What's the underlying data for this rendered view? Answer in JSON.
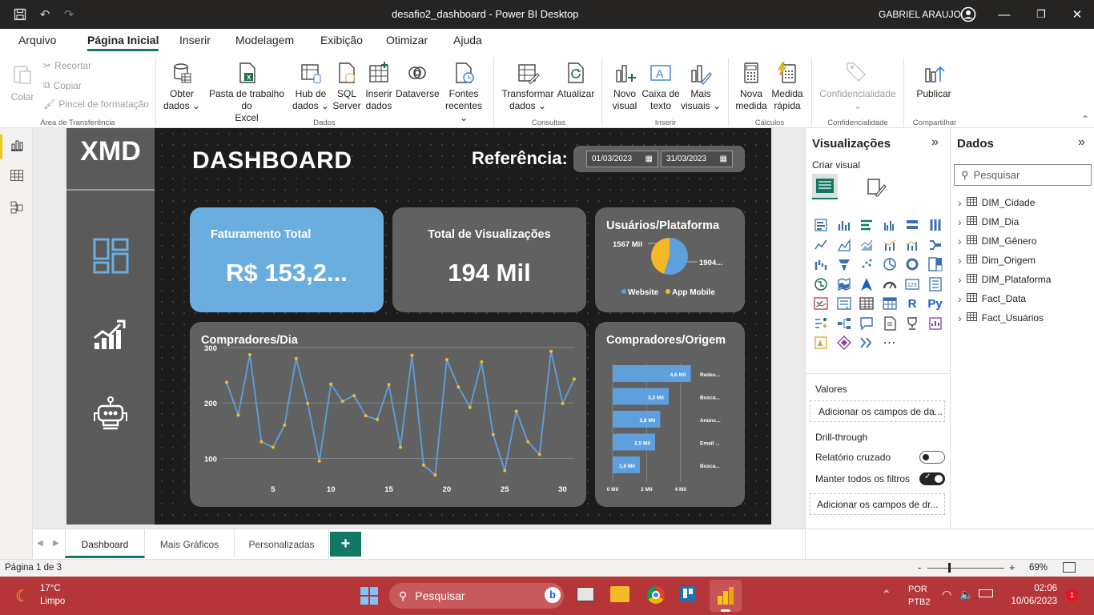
{
  "window": {
    "title": "desafio2_dashboard - Power BI Desktop",
    "user": "GABRIEL ARAUJO"
  },
  "ribbon_tabs": [
    "Arquivo",
    "Página Inicial",
    "Inserir",
    "Modelagem",
    "Exibição",
    "Otimizar",
    "Ajuda"
  ],
  "ribbon": {
    "paste": "Colar",
    "cut": "Recortar",
    "copy": "Copiar",
    "format_painter": "Pincel de formatação",
    "get_data": [
      "Obter",
      "dados ⌄"
    ],
    "excel": [
      "Pasta de trabalho do",
      "Excel"
    ],
    "hub": [
      "Hub de",
      "dados ⌄"
    ],
    "sql": [
      "SQL",
      "Server"
    ],
    "enter_data": [
      "Inserir",
      "dados"
    ],
    "dataverse": "Dataverse",
    "recent": [
      "Fontes",
      "recentes ⌄"
    ],
    "transform": [
      "Transformar",
      "dados ⌄"
    ],
    "refresh": "Atualizar",
    "new_visual": [
      "Novo",
      "visual"
    ],
    "textbox": [
      "Caixa de",
      "texto"
    ],
    "more_visuals": [
      "Mais",
      "visuais ⌄"
    ],
    "new_measure": [
      "Nova",
      "medida"
    ],
    "quick_measure": [
      "Medida",
      "rápida"
    ],
    "sensitivity": "Confidencialidade",
    "publish": "Publicar",
    "groups": [
      "Área de Transferência",
      "Dados",
      "Consultas",
      "Inserir",
      "Cálculos",
      "Confidencialidade",
      "Compartilhar"
    ]
  },
  "report": {
    "logo": "XMD",
    "title": "DASHBOARD",
    "reference_label": "Referência:",
    "date_from": "01/03/2023",
    "date_to": "31/03/2023",
    "kpi1": {
      "label": "Faturamento Total",
      "value": "R$ 153,2..."
    },
    "kpi2": {
      "label": "Total de Visualizações",
      "value": "194 Mil"
    },
    "pie": {
      "title": "Usuários/Plataforma",
      "label_a": "1567 Mil",
      "label_b": "1904...",
      "legend": [
        "Website",
        "App Mobile"
      ]
    },
    "line_title": "Compradores/Dia",
    "bar_title": "Compradores/Origem"
  },
  "chart_data": [
    {
      "type": "pie",
      "title": "Usuários/Plataforma",
      "labels": [
        "Website",
        "App Mobile"
      ],
      "values": [
        1904,
        1567
      ],
      "colors": [
        "#5ea0de",
        "#f4b927"
      ]
    },
    {
      "type": "line",
      "title": "Compradores/Dia",
      "x": [
        1,
        2,
        3,
        4,
        5,
        6,
        7,
        8,
        9,
        10,
        11,
        12,
        13,
        14,
        15,
        16,
        17,
        18,
        19,
        20,
        21,
        22,
        23,
        24,
        25,
        26,
        27,
        28,
        29,
        30,
        31
      ],
      "values": [
        237,
        178,
        287,
        130,
        120,
        160,
        280,
        199,
        95,
        234,
        203,
        213,
        177,
        170,
        233,
        120,
        286,
        88,
        70,
        278,
        229,
        192,
        274,
        143,
        78,
        185,
        130,
        107,
        293,
        199,
        243
      ],
      "xticks": [
        5,
        10,
        15,
        20,
        25,
        30
      ],
      "yticks": [
        100,
        200,
        300
      ],
      "ylim": [
        50,
        310
      ]
    },
    {
      "type": "bar",
      "title": "Compradores/Origem",
      "categories": [
        "Redes...",
        "Busca...",
        "Anúnc...",
        "Email ...",
        "Busca..."
      ],
      "values": [
        4.6,
        3.3,
        2.8,
        2.5,
        1.6
      ],
      "value_labels": [
        "4,6 Mil",
        "3,3 Mil",
        "2,8 Mil",
        "2,5 Mil",
        "1,6 Mil"
      ],
      "xticks": [
        "0 Mil",
        "2 Mil",
        "4 Mil"
      ],
      "xlim": [
        0,
        5
      ]
    }
  ],
  "viz_pane": {
    "title": "Visualizações",
    "build": "Criar visual",
    "values_label": "Valores",
    "values_placeholder": "Adicionar os campos de da...",
    "drill": "Drill-through",
    "cross": "Relatório cruzado",
    "keep": "Manter todos os filtros",
    "drill_placeholder": "Adicionar os campos de dr..."
  },
  "data_pane": {
    "title": "Dados",
    "search": "Pesquisar",
    "fields": [
      "DIM_Cidade",
      "DIM_Dia",
      "DIM_Gênero",
      "Dim_Origem",
      "DIM_Plataforma",
      "Fact_Data",
      "Fact_Usuários"
    ]
  },
  "pages": [
    "Dashboard",
    "Mais Gráficos",
    "Personalizadas"
  ],
  "status": {
    "page": "Página 1 de 3",
    "zoom": "69%"
  },
  "taskbar": {
    "temp": "17°C",
    "weather": "Limpo",
    "search": "Pesquisar",
    "lang1": "POR",
    "lang2": "PTB2",
    "time": "02:06",
    "date": "10/06/2023",
    "badge": "1"
  },
  "colors": {
    "accent": "#117865",
    "kpi_blue": "#6aaee0",
    "card": "#616161",
    "line": "#5ea0de",
    "marker": "#f4b927"
  }
}
